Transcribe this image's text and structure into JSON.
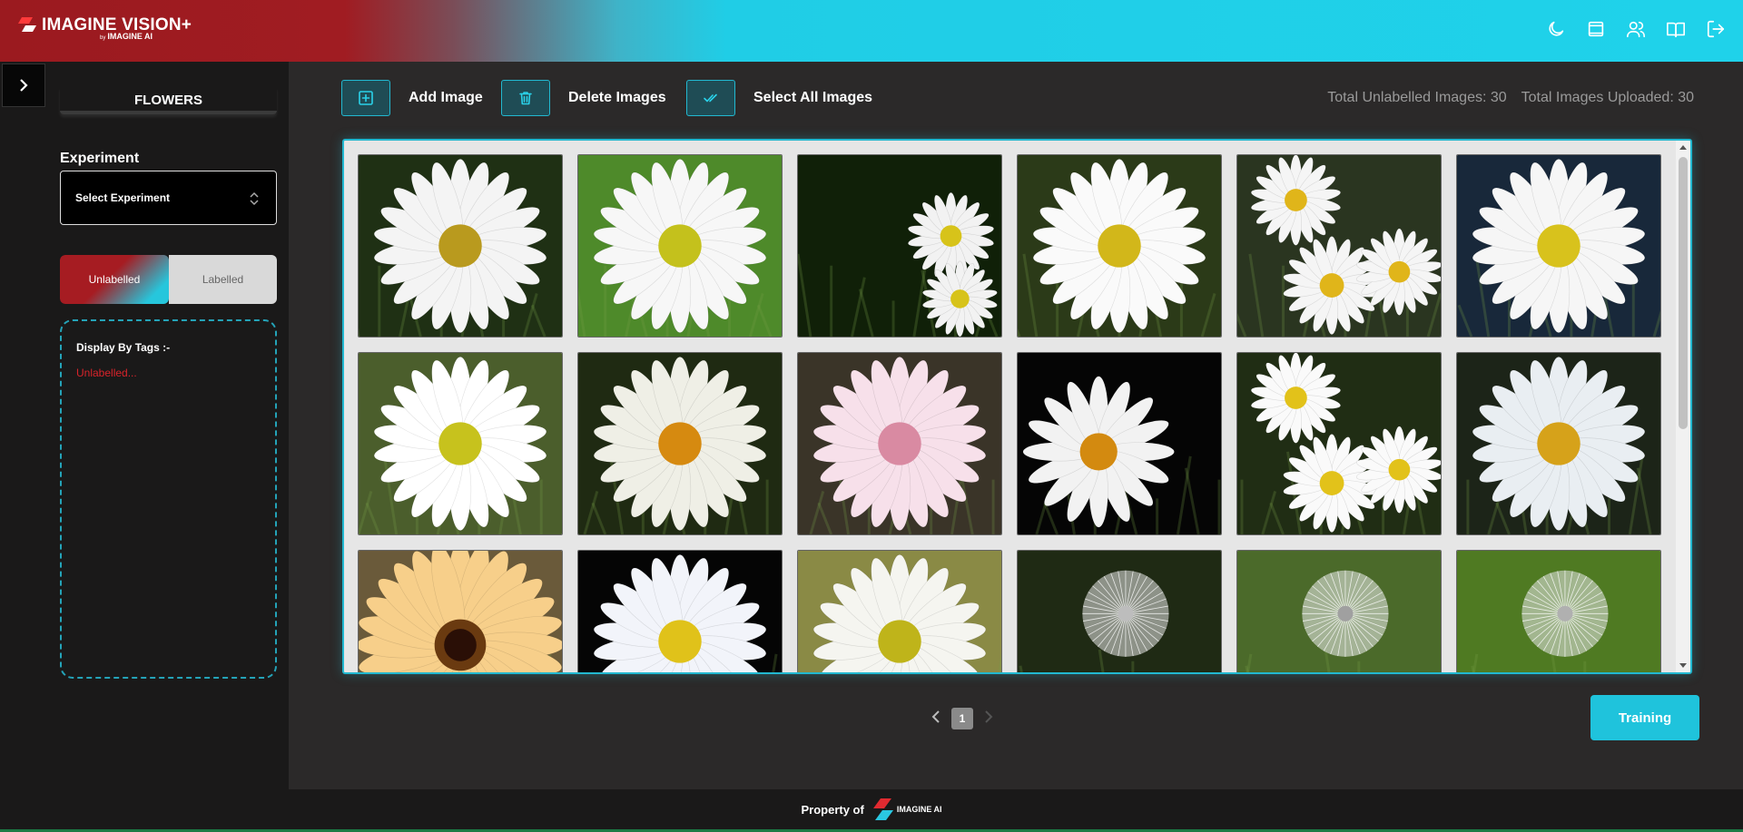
{
  "header": {
    "logo_title": "IMAGINE VISION+",
    "logo_by": "by",
    "logo_sub": "IMAGINE AI",
    "icons": [
      "moon-icon",
      "monitor-icon",
      "users-icon",
      "book-icon",
      "logout-icon"
    ]
  },
  "sidebar": {
    "project_name": "FLOWERS",
    "experiment_label": "Experiment",
    "experiment_select": "Select Experiment",
    "toggle": {
      "unlabelled": "Unlabelled",
      "labelled": "Labelled",
      "active": "unlabelled"
    },
    "tags_title": "Display By Tags :-",
    "tags_empty": "Unlabelled..."
  },
  "toolbar": {
    "add_label": "Add Image",
    "delete_label": "Delete Images",
    "select_all_label": "Select All Images",
    "stat_unlabelled": "Total Unlabelled Images: 30",
    "stat_uploaded": "Total Images Uploaded: 30"
  },
  "gallery": {
    "images": [
      {
        "kind": "daisy",
        "bg": "#1f3014",
        "petal": "#f4f4f4",
        "center": "#b99a1e"
      },
      {
        "kind": "daisy",
        "bg": "#4e8a2a",
        "petal": "#f7f7f7",
        "center": "#c4c11c"
      },
      {
        "kind": "daisy-pair",
        "bg": "#102008",
        "petal": "#f2f2f2",
        "center": "#d7c31a"
      },
      {
        "kind": "daisy",
        "bg": "#2b3a18",
        "petal": "#fafafa",
        "center": "#d2b71a"
      },
      {
        "kind": "daisy-cluster",
        "bg": "#2a3520",
        "petal": "#f5f5f5",
        "center": "#e0b51a"
      },
      {
        "kind": "daisy",
        "bg": "#18283a",
        "petal": "#f6f6f6",
        "center": "#d8c21c"
      },
      {
        "kind": "daisy",
        "bg": "#4b5e2c",
        "petal": "#ffffff",
        "center": "#c7c21d"
      },
      {
        "kind": "daisy",
        "bg": "#1f2a12",
        "petal": "#efefe6",
        "center": "#d68a10"
      },
      {
        "kind": "daisy",
        "bg": "#3a3428",
        "petal": "#f7e0ea",
        "center": "#d98aa2"
      },
      {
        "kind": "daisy-side",
        "bg": "#050505",
        "petal": "#f2f2f2",
        "center": "#d38a10"
      },
      {
        "kind": "daisy-cluster",
        "bg": "#202d14",
        "petal": "#fafafa",
        "center": "#e2c21a"
      },
      {
        "kind": "daisy",
        "bg": "#1c2418",
        "petal": "#e9eef2",
        "center": "#d6a21a"
      },
      {
        "kind": "gerbera",
        "bg": "#6a5a3a",
        "petal": "#f7cf8a",
        "center": "#2a0f06"
      },
      {
        "kind": "daisy",
        "bg": "#050505",
        "petal": "#f2f4fa",
        "center": "#e0c21a"
      },
      {
        "kind": "daisy",
        "bg": "#8a8a45",
        "petal": "#f5f5f0",
        "center": "#bfb41a"
      },
      {
        "kind": "dandelion",
        "bg": "#1f2a14",
        "petal": "#e8e8e8",
        "center": "#bdbdbd"
      },
      {
        "kind": "dandelion",
        "bg": "#4b6a2a",
        "petal": "#efefef",
        "center": "#a0a0a0"
      },
      {
        "kind": "dandelion",
        "bg": "#4f7a22",
        "petal": "#e8e8ea",
        "center": "#b0b0b0"
      }
    ]
  },
  "pagination": {
    "current": "1"
  },
  "actions": {
    "training_label": "Training"
  },
  "footer": {
    "text": "Property of",
    "logo_text": "IMAGINE AI"
  }
}
